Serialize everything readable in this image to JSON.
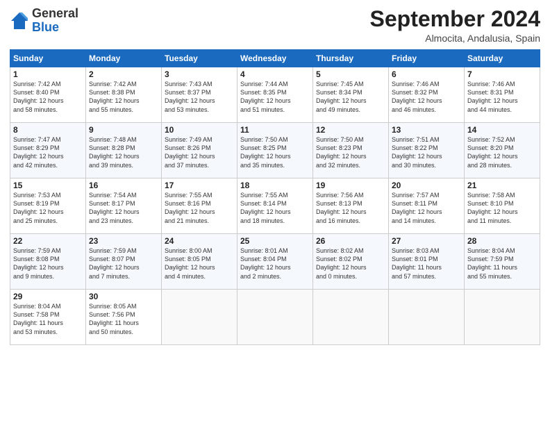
{
  "logo": {
    "general": "General",
    "blue": "Blue"
  },
  "header": {
    "month_title": "September 2024",
    "location": "Almocita, Andalusia, Spain"
  },
  "days_of_week": [
    "Sunday",
    "Monday",
    "Tuesday",
    "Wednesday",
    "Thursday",
    "Friday",
    "Saturday"
  ],
  "weeks": [
    [
      {
        "day": "1",
        "info": "Sunrise: 7:42 AM\nSunset: 8:40 PM\nDaylight: 12 hours\nand 58 minutes."
      },
      {
        "day": "2",
        "info": "Sunrise: 7:42 AM\nSunset: 8:38 PM\nDaylight: 12 hours\nand 55 minutes."
      },
      {
        "day": "3",
        "info": "Sunrise: 7:43 AM\nSunset: 8:37 PM\nDaylight: 12 hours\nand 53 minutes."
      },
      {
        "day": "4",
        "info": "Sunrise: 7:44 AM\nSunset: 8:35 PM\nDaylight: 12 hours\nand 51 minutes."
      },
      {
        "day": "5",
        "info": "Sunrise: 7:45 AM\nSunset: 8:34 PM\nDaylight: 12 hours\nand 49 minutes."
      },
      {
        "day": "6",
        "info": "Sunrise: 7:46 AM\nSunset: 8:32 PM\nDaylight: 12 hours\nand 46 minutes."
      },
      {
        "day": "7",
        "info": "Sunrise: 7:46 AM\nSunset: 8:31 PM\nDaylight: 12 hours\nand 44 minutes."
      }
    ],
    [
      {
        "day": "8",
        "info": "Sunrise: 7:47 AM\nSunset: 8:29 PM\nDaylight: 12 hours\nand 42 minutes."
      },
      {
        "day": "9",
        "info": "Sunrise: 7:48 AM\nSunset: 8:28 PM\nDaylight: 12 hours\nand 39 minutes."
      },
      {
        "day": "10",
        "info": "Sunrise: 7:49 AM\nSunset: 8:26 PM\nDaylight: 12 hours\nand 37 minutes."
      },
      {
        "day": "11",
        "info": "Sunrise: 7:50 AM\nSunset: 8:25 PM\nDaylight: 12 hours\nand 35 minutes."
      },
      {
        "day": "12",
        "info": "Sunrise: 7:50 AM\nSunset: 8:23 PM\nDaylight: 12 hours\nand 32 minutes."
      },
      {
        "day": "13",
        "info": "Sunrise: 7:51 AM\nSunset: 8:22 PM\nDaylight: 12 hours\nand 30 minutes."
      },
      {
        "day": "14",
        "info": "Sunrise: 7:52 AM\nSunset: 8:20 PM\nDaylight: 12 hours\nand 28 minutes."
      }
    ],
    [
      {
        "day": "15",
        "info": "Sunrise: 7:53 AM\nSunset: 8:19 PM\nDaylight: 12 hours\nand 25 minutes."
      },
      {
        "day": "16",
        "info": "Sunrise: 7:54 AM\nSunset: 8:17 PM\nDaylight: 12 hours\nand 23 minutes."
      },
      {
        "day": "17",
        "info": "Sunrise: 7:55 AM\nSunset: 8:16 PM\nDaylight: 12 hours\nand 21 minutes."
      },
      {
        "day": "18",
        "info": "Sunrise: 7:55 AM\nSunset: 8:14 PM\nDaylight: 12 hours\nand 18 minutes."
      },
      {
        "day": "19",
        "info": "Sunrise: 7:56 AM\nSunset: 8:13 PM\nDaylight: 12 hours\nand 16 minutes."
      },
      {
        "day": "20",
        "info": "Sunrise: 7:57 AM\nSunset: 8:11 PM\nDaylight: 12 hours\nand 14 minutes."
      },
      {
        "day": "21",
        "info": "Sunrise: 7:58 AM\nSunset: 8:10 PM\nDaylight: 12 hours\nand 11 minutes."
      }
    ],
    [
      {
        "day": "22",
        "info": "Sunrise: 7:59 AM\nSunset: 8:08 PM\nDaylight: 12 hours\nand 9 minutes."
      },
      {
        "day": "23",
        "info": "Sunrise: 7:59 AM\nSunset: 8:07 PM\nDaylight: 12 hours\nand 7 minutes."
      },
      {
        "day": "24",
        "info": "Sunrise: 8:00 AM\nSunset: 8:05 PM\nDaylight: 12 hours\nand 4 minutes."
      },
      {
        "day": "25",
        "info": "Sunrise: 8:01 AM\nSunset: 8:04 PM\nDaylight: 12 hours\nand 2 minutes."
      },
      {
        "day": "26",
        "info": "Sunrise: 8:02 AM\nSunset: 8:02 PM\nDaylight: 12 hours\nand 0 minutes."
      },
      {
        "day": "27",
        "info": "Sunrise: 8:03 AM\nSunset: 8:01 PM\nDaylight: 11 hours\nand 57 minutes."
      },
      {
        "day": "28",
        "info": "Sunrise: 8:04 AM\nSunset: 7:59 PM\nDaylight: 11 hours\nand 55 minutes."
      }
    ],
    [
      {
        "day": "29",
        "info": "Sunrise: 8:04 AM\nSunset: 7:58 PM\nDaylight: 11 hours\nand 53 minutes."
      },
      {
        "day": "30",
        "info": "Sunrise: 8:05 AM\nSunset: 7:56 PM\nDaylight: 11 hours\nand 50 minutes."
      },
      {
        "day": "",
        "info": ""
      },
      {
        "day": "",
        "info": ""
      },
      {
        "day": "",
        "info": ""
      },
      {
        "day": "",
        "info": ""
      },
      {
        "day": "",
        "info": ""
      }
    ]
  ]
}
